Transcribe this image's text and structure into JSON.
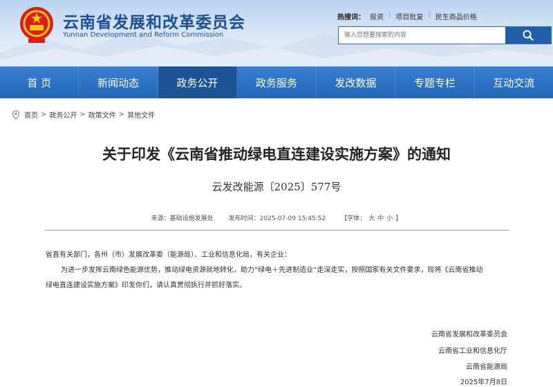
{
  "header": {
    "site_title": "云南省发展和改革委员会",
    "site_subtitle": "Yunnan Development and Reform Commission",
    "hot_label": "热搜词：",
    "hot_links": [
      "投资",
      "项目批复",
      "民生商品价格"
    ],
    "search_placeholder": "输入您想要搜索的内容",
    "icons": {
      "emblem": "national-emblem-icon",
      "search": "search-icon"
    },
    "colors": {
      "brand": "#1a4f97",
      "nav": "#2266b6",
      "nav_active": "#1c5296"
    }
  },
  "nav": {
    "items": [
      {
        "label": "首 页"
      },
      {
        "label": "新闻动态"
      },
      {
        "label": "政务公开",
        "active": true
      },
      {
        "label": "政务服务"
      },
      {
        "label": "发改数据"
      },
      {
        "label": "专题专栏"
      },
      {
        "label": "互动交流"
      }
    ]
  },
  "breadcrumb": {
    "items": [
      "首页",
      "政务公开",
      "政策文件",
      "其他文件"
    ],
    "separator": ">",
    "icon": "location-pin-icon"
  },
  "article": {
    "title": "关于印发《云南省推动绿电直连建设实施方案》的通知",
    "doc_number": "云发改能源〔2025〕577号",
    "source": "来源：基础设施发展处",
    "publish_time": "发布时间：2025-07-09 15:45:52",
    "font_size": {
      "prefix": "【字体：",
      "large": "大",
      "medium": "中",
      "small": "小",
      "suffix": "】"
    },
    "salutation": "省直有关部门，各州（市）发展改革委（能源局）、工业和信息化局，有关企业：",
    "paragraph_line1": "为进一步发挥云南绿色能源优势，推动绿电资源就地转化，助力“绿电＋先进制造业”走深走实，按照国家有关文件要求，现将《云南省推动",
    "paragraph_line2": "绿电直连建设实施方案》印发你们，请认真贯彻执行并抓好落实。",
    "signatures": [
      "云南省发展和改革委员会",
      "云南省工业和信息化厅",
      "云南省能源局"
    ],
    "date": "2025年7月8日"
  }
}
